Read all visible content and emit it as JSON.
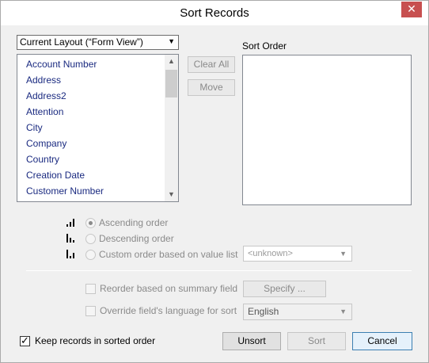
{
  "window": {
    "title": "Sort Records",
    "close_glyph": "✕"
  },
  "layout_select": {
    "value": "Current Layout (“Form View”)"
  },
  "fields": [
    "Account Number",
    "Address",
    "Address2",
    "Attention",
    "City",
    "Company",
    "Country",
    "Creation Date",
    "Customer Number"
  ],
  "buttons": {
    "clear_all": "Clear All",
    "move": "Move",
    "specify": "Specify ...",
    "unsort": "Unsort",
    "sort": "Sort",
    "cancel": "Cancel"
  },
  "sort_order": {
    "label": "Sort Order"
  },
  "order_options": {
    "ascending": "Ascending order",
    "descending": "Descending order",
    "custom": "Custom order based on value list",
    "value_list": "<unknown>"
  },
  "options": {
    "reorder_summary": "Reorder based on summary field",
    "override_language": "Override field's language for sort",
    "language": "English",
    "keep_sorted": "Keep records in sorted order"
  },
  "icons": {
    "scroll_up": "▲",
    "scroll_down": "▼",
    "chevron": "▼"
  }
}
